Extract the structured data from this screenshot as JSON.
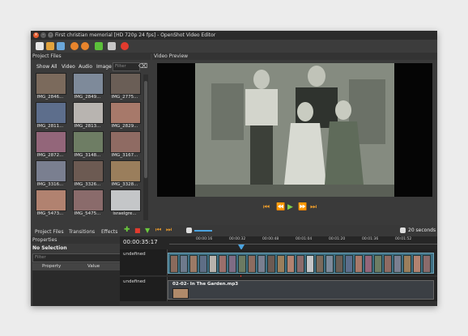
{
  "window": {
    "title": "First christian memorial [HD 720p 24 fps] - OpenShot Video Editor"
  },
  "toolbar": {
    "icons": [
      "new-project-icon",
      "open-project-icon",
      "save-project-icon",
      "undo-icon",
      "redo-icon",
      "add-track-icon",
      "export-icon",
      "record-icon"
    ]
  },
  "project_files": {
    "title": "Project Files",
    "filters": [
      "Show All",
      "Video",
      "Audio",
      "Image"
    ],
    "filter_placeholder": "Filter",
    "thumbnails": [
      {
        "label": "IMG_2846..."
      },
      {
        "label": "IMG_2849..."
      },
      {
        "label": "IMG_2775..."
      },
      {
        "label": "IMG_2811..."
      },
      {
        "label": "IMG_2813..."
      },
      {
        "label": "IMG_2829..."
      },
      {
        "label": "IMG_2872..."
      },
      {
        "label": "IMG_3148..."
      },
      {
        "label": "IMG_3167..."
      },
      {
        "label": "IMG_3316..."
      },
      {
        "label": "IMG_3326..."
      },
      {
        "label": "IMG_3328..."
      },
      {
        "label": "IMG_5473..."
      },
      {
        "label": "IMG_5475..."
      },
      {
        "label": "israelgre..."
      }
    ],
    "tabs": [
      "Project Files",
      "Transitions",
      "Effects"
    ]
  },
  "properties": {
    "title": "Properties",
    "selection": "No Selection",
    "filter_placeholder": "Filter",
    "columns": [
      "Property",
      "Value"
    ]
  },
  "video_preview": {
    "title": "Video Preview",
    "controls": [
      "jump-start-icon",
      "rewind-icon",
      "play-icon",
      "fast-forward-icon",
      "jump-end-icon"
    ]
  },
  "timeline": {
    "duration_label": "20 seconds",
    "timecode": "00:00:35:17",
    "ruler_ticks": [
      "00:00:16",
      "00:00:32",
      "00:00:48",
      "00:01:04",
      "00:01:20",
      "00:01:36",
      "00:01:52"
    ],
    "tracks": [
      {
        "name": "undefined"
      },
      {
        "name": "undefined",
        "clip_label": "02-02- In The Garden.mp3"
      }
    ]
  }
}
